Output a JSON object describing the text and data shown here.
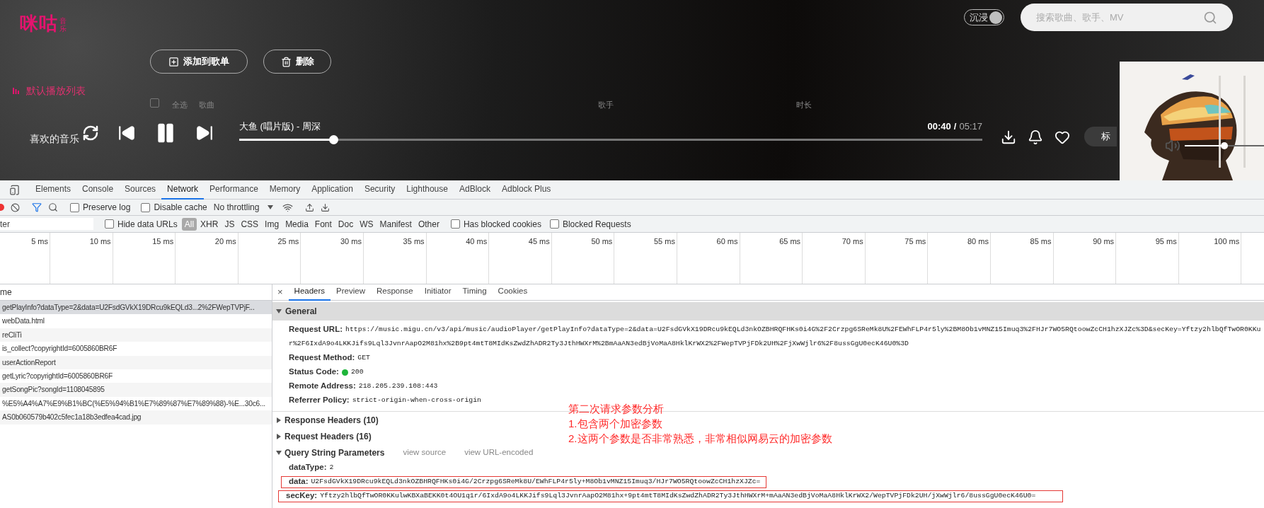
{
  "header": {
    "logo": "咪咕",
    "logo_sub": "音乐",
    "immersive_toggle": {
      "label": "沉浸",
      "on": true
    },
    "search": {
      "placeholder": "搜索歌曲、歌手、MV"
    }
  },
  "actions": [
    {
      "kind": "add",
      "label": "添加到歌单"
    },
    {
      "kind": "delete",
      "label": "删除"
    }
  ],
  "playlist_label": "默认播放列表",
  "columns": {
    "select_all": {
      "label": "全选",
      "checked": false
    },
    "song": "歌曲",
    "artist": "歌手",
    "duration": "时长"
  },
  "sidebar_item": "喜欢的音乐",
  "player": {
    "title": "大鱼 (唱片版) - 周深",
    "elapsed": "00:40",
    "separator": "/",
    "total": "05:17",
    "level": 0.127,
    "playing": true,
    "extra_button": "标",
    "volume": {
      "level": 0.5
    }
  },
  "devtools": {
    "tabs": [
      {
        "label": "Elements",
        "selected": false
      },
      {
        "label": "Console",
        "selected": false
      },
      {
        "label": "Sources",
        "selected": false
      },
      {
        "label": "Network",
        "selected": true
      },
      {
        "label": "Performance",
        "selected": false
      },
      {
        "label": "Memory",
        "selected": false
      },
      {
        "label": "Application",
        "selected": false
      },
      {
        "label": "Security",
        "selected": false
      },
      {
        "label": "Lighthouse",
        "selected": false
      },
      {
        "label": "AdBlock",
        "selected": false
      },
      {
        "label": "Adblock Plus",
        "selected": false
      }
    ],
    "toolbar": {
      "preserve_log": {
        "label": "Preserve log",
        "checked": false
      },
      "disable_cache": {
        "label": "Disable cache",
        "checked": false
      },
      "throttling": "No throttling"
    },
    "filter": {
      "placeholder": "ter",
      "hide_data_urls": {
        "label": "Hide data URLs",
        "checked": false
      },
      "types": [
        {
          "label": "All",
          "selected": true
        },
        {
          "label": "XHR",
          "selected": false
        },
        {
          "label": "JS",
          "selected": false
        },
        {
          "label": "CSS",
          "selected": false
        },
        {
          "label": "Img",
          "selected": false
        },
        {
          "label": "Media",
          "selected": false
        },
        {
          "label": "Font",
          "selected": false
        },
        {
          "label": "Doc",
          "selected": false
        },
        {
          "label": "WS",
          "selected": false
        },
        {
          "label": "Manifest",
          "selected": false
        },
        {
          "label": "Other",
          "selected": false
        }
      ],
      "has_blocked_cookies": {
        "label": "Has blocked cookies",
        "checked": false
      },
      "blocked_requests": {
        "label": "Blocked Requests",
        "checked": false
      }
    },
    "timeline_ticks": [
      "5 ms",
      "10 ms",
      "15 ms",
      "20 ms",
      "25 ms",
      "30 ms",
      "35 ms",
      "40 ms",
      "45 ms",
      "50 ms",
      "55 ms",
      "60 ms",
      "65 ms",
      "70 ms",
      "75 ms",
      "80 ms",
      "85 ms",
      "90 ms",
      "95 ms",
      "100 ms"
    ],
    "requests": {
      "header": "me",
      "rows": [
        {
          "name": "getPlayInfo?dataType=2&data=U2FsdGVkX19DRcu9kEQLd3...2%2FWepTVPjF...",
          "selected": true
        },
        {
          "name": "webData.html",
          "selected": false
        },
        {
          "name": "reCliTi",
          "selected": false
        },
        {
          "name": "is_collect?copyrightId=6005860BR6F",
          "selected": false
        },
        {
          "name": "userActionReport",
          "selected": false
        },
        {
          "name": "getLyric?copyrightId=6005860BR6F",
          "selected": false
        },
        {
          "name": "getSongPic?songId=1108045895",
          "selected": false
        },
        {
          "name": "%E5%A4%A7%E9%B1%BC(%E5%94%B1%E7%89%87%E7%89%88)-%E...30c6...",
          "selected": false
        },
        {
          "name": "AS0b060579b402c5fec1a18b3edfea4cad.jpg",
          "selected": false
        }
      ]
    },
    "detail": {
      "close": "×",
      "tabs": [
        {
          "label": "Headers",
          "selected": true
        },
        {
          "label": "Preview",
          "selected": false
        },
        {
          "label": "Response",
          "selected": false
        },
        {
          "label": "Initiator",
          "selected": false
        },
        {
          "label": "Timing",
          "selected": false
        },
        {
          "label": "Cookies",
          "selected": false
        }
      ],
      "general": {
        "title": "General",
        "expanded": true,
        "fields": [
          {
            "kind": "text",
            "label": "Request URL:",
            "lines": [
              "https://music.migu.cn/v3/api/music/audioPlayer/getPlayInfo?dataType=2&data=U2FsdGVkX19DRcu9kEQLd3nkOZBHRQFHKs0i4G%2F2Crzpg6SReMk8U%2FEWhFLP4r5ly%2BM8Ob1vMNZ15Imuq3%2FHJr7WO5RQtoowZcCH1hzXJZc%3D&secKey=Yftzy2hlbQfTwOR0KKu",
              "r%2F6IxdA9o4LKKJifs9Lql3JvnrAapO2M81hx%2B9pt4mtT8MIdKsZwdZhADR2Ty3JthHWXrM%2BmAaAN3edBjVoMaA8HklKrWX2%2FWepTVPjFDk2UH%2FjXwWjlr6%2F8ussGgU0ecK46U0%3D"
            ]
          },
          {
            "kind": "text",
            "label": "Request Method:",
            "lines": [
              "GET"
            ]
          },
          {
            "kind": "status",
            "label": "Status Code:",
            "lines": [
              "200"
            ]
          },
          {
            "kind": "text",
            "label": "Remote Address:",
            "lines": [
              "218.205.239.108:443"
            ]
          },
          {
            "kind": "text",
            "label": "Referrer Policy:",
            "lines": [
              "strict-origin-when-cross-origin"
            ]
          }
        ]
      },
      "sections": [
        {
          "title": "Response Headers (10)",
          "expanded": false
        },
        {
          "title": "Request Headers (16)",
          "expanded": false
        }
      ],
      "query": {
        "title": "Query String Parameters",
        "expanded": true,
        "links": [
          "view source",
          "view URL-encoded"
        ],
        "params": [
          {
            "name": "dataType:",
            "value": "2",
            "highlighted": false
          },
          {
            "name": "data:",
            "value": "U2FsdGVkX19DRcu9kEQLd3nkOZBHRQFHKs0i4G/2Crzpg6SReMk8U/EWhFLP4r5ly+M8Ob1vMNZ15Imuq3/HJr7WO5RQtoowZcCH1hzXJZc=",
            "highlighted": true
          },
          {
            "name": "secKey:",
            "value": "Yftzy2hlbQfTwOR0KKulwKBXaBEKK0t4OU1q1r/6IxdA9o4LKKJifs9Lql3JvnrAapO2M81hx+9pt4mtT8MIdKsZwdZhADR2Ty3JthHWXrM+mAaAN3edBjVoMaA8HklKrWX2/WepTVPjFDk2UH/jXwWjlr6/8ussGgU0ecK46U0=",
            "highlighted": true
          }
        ]
      }
    },
    "annotation": [
      "第二次请求参数分析",
      "1.包含两个加密参数",
      "2.这两个参数是否非常熟悉，非常相似网易云的加密参数"
    ]
  }
}
